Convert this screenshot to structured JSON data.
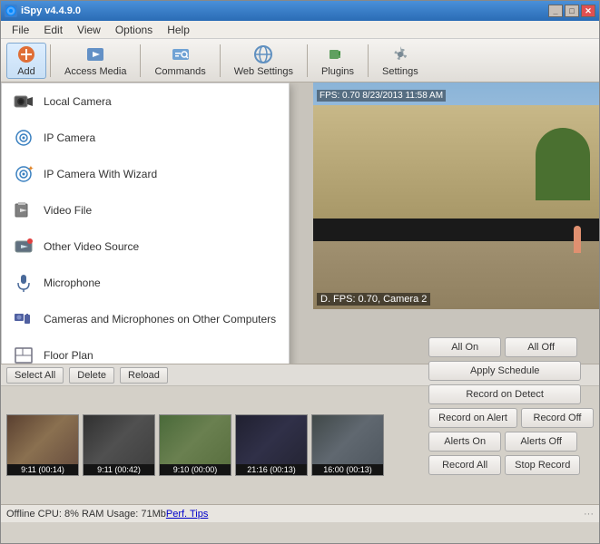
{
  "window": {
    "title": "iSpy v4.4.9.0",
    "controls": [
      "minimize",
      "maximize",
      "close"
    ]
  },
  "menubar": {
    "items": [
      "File",
      "Edit",
      "View",
      "Options",
      "Help"
    ]
  },
  "toolbar": {
    "buttons": [
      {
        "id": "add",
        "label": "Add",
        "active": true
      },
      {
        "id": "access-media",
        "label": "Access Media"
      },
      {
        "id": "commands",
        "label": "Commands"
      },
      {
        "id": "web-settings",
        "label": "Web Settings"
      },
      {
        "id": "plugins",
        "label": "Plugins"
      },
      {
        "id": "settings",
        "label": "Settings"
      }
    ]
  },
  "dropdown": {
    "items": [
      {
        "id": "local-camera",
        "label": "Local Camera"
      },
      {
        "id": "ip-camera",
        "label": "IP Camera"
      },
      {
        "id": "ip-camera-wizard",
        "label": "IP Camera With Wizard"
      },
      {
        "id": "video-file",
        "label": "Video File"
      },
      {
        "id": "other-video-source",
        "label": "Other Video Source"
      },
      {
        "id": "microphone",
        "label": "Microphone"
      },
      {
        "id": "cameras-and-microphones",
        "label": "Cameras and Microphones on Other Computers"
      },
      {
        "id": "floor-plan",
        "label": "Floor Plan"
      }
    ]
  },
  "camera": {
    "info_top": "FPS: 0.70 8/23/2013 11:58 AM",
    "info_bottom": "D. FPS: 0.70, Camera 2"
  },
  "bottom_toolbar": {
    "buttons": [
      "Select All",
      "Delete",
      "Reload"
    ]
  },
  "thumbnails": [
    {
      "label": "9:11 (00:14)"
    },
    {
      "label": "9:11 (00:42)"
    },
    {
      "label": "9:10 (00:00)"
    },
    {
      "label": "21:16 (00:13)"
    },
    {
      "label": "16:00 (00:13)"
    }
  ],
  "right_buttons": {
    "rows": [
      [
        {
          "label": "All On",
          "id": "all-on"
        },
        {
          "label": "All Off",
          "id": "all-off"
        }
      ],
      [
        {
          "label": "Apply Schedule",
          "id": "apply-schedule"
        }
      ],
      [
        {
          "label": "Record on Detect",
          "id": "record-on-detect"
        }
      ],
      [
        {
          "label": "Record on Alert",
          "id": "record-on-alert"
        },
        {
          "label": "Record Off",
          "id": "record-off"
        }
      ],
      [
        {
          "label": "Alerts On",
          "id": "alerts-on"
        },
        {
          "label": "Alerts Off",
          "id": "alerts-off"
        }
      ],
      [
        {
          "label": "Record All",
          "id": "record-all"
        },
        {
          "label": "Stop Record",
          "id": "stop-record"
        }
      ]
    ]
  },
  "status": {
    "text": "Offline  CPU: 8% RAM Usage: 71Mb ",
    "link": "Perf. Tips"
  }
}
